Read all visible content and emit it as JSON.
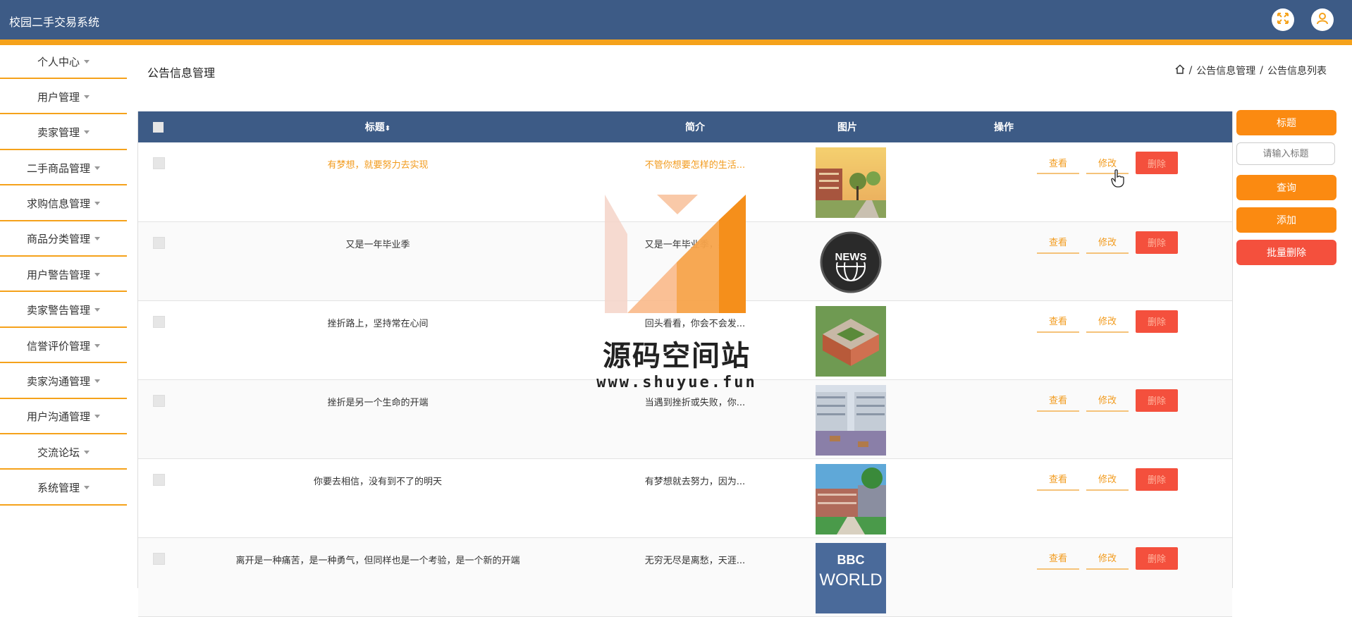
{
  "app": {
    "title": "校园二手交易系统"
  },
  "sidebar": {
    "items": [
      {
        "label": "个人中心"
      },
      {
        "label": "用户管理"
      },
      {
        "label": "卖家管理"
      },
      {
        "label": "二手商品管理"
      },
      {
        "label": "求购信息管理"
      },
      {
        "label": "商品分类管理"
      },
      {
        "label": "用户警告管理"
      },
      {
        "label": "卖家警告管理"
      },
      {
        "label": "信誉评价管理"
      },
      {
        "label": "卖家沟通管理"
      },
      {
        "label": "用户沟通管理"
      },
      {
        "label": "交流论坛"
      },
      {
        "label": "系统管理"
      }
    ]
  },
  "page": {
    "title": "公告信息管理",
    "breadcrumb": {
      "sep": "/",
      "level1": "公告信息管理",
      "level2": "公告信息列表"
    }
  },
  "table": {
    "headers": {
      "title": "标题",
      "summary": "简介",
      "image": "图片",
      "actions": "操作"
    },
    "actions": {
      "view": "查看",
      "edit": "修改",
      "delete": "删除"
    },
    "rows": [
      {
        "title": "有梦想，就要努力去实现",
        "summary": "不管你想要怎样的生活...",
        "image": "campus-photo-1"
      },
      {
        "title": "又是一年毕业季",
        "summary": "又是一年毕业季，感慨...",
        "image": "news-icon"
      },
      {
        "title": "挫折路上，坚持常在心间",
        "summary": "回头看看，你会不会发...",
        "image": "campus-photo-2"
      },
      {
        "title": "挫折是另一个生命的开端",
        "summary": "当遇到挫折或失败，你...",
        "image": "campus-photo-3"
      },
      {
        "title": "你要去相信，没有到不了的明天",
        "summary": "有梦想就去努力，因为...",
        "image": "campus-photo-4"
      },
      {
        "title": "离开是一种痛苦，是一种勇气，但同样也是一个考验，是一个新的开端",
        "summary": "无穷无尽是离愁，天涯...",
        "image": "bbc-world-logo"
      }
    ]
  },
  "right_panel": {
    "search_label": "标题",
    "search_placeholder": "请输入标题",
    "query": "查询",
    "add": "添加",
    "batch_delete": "批量删除"
  },
  "news_logo_text": "NEWS",
  "bbc_text": {
    "top": "BBC",
    "bottom": "WORLD"
  },
  "watermark": {
    "title": "源码空间站",
    "url": "www.shuyue.fun"
  },
  "colors": {
    "header": "#3d5b86",
    "accent": "#f5a21b",
    "button": "#fb8a11",
    "danger": "#f4503d"
  }
}
